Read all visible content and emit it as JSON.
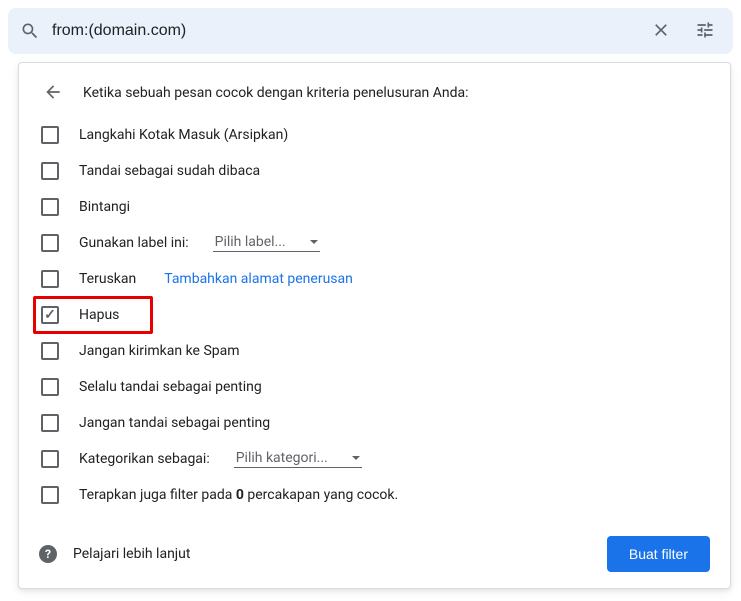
{
  "search": {
    "query": "from:(domain.com)"
  },
  "panel": {
    "title": "Ketika sebuah pesan cocok dengan kriteria penelusuran Anda:",
    "learn_more": "Pelajari lebih lanjut",
    "create_filter": "Buat filter"
  },
  "label_dropdown": {
    "placeholder": "Pilih label..."
  },
  "category_dropdown": {
    "placeholder": "Pilih kategori..."
  },
  "forward": {
    "add_link": "Tambahkan alamat penerusan"
  },
  "apply_existing": {
    "prefix": "Terapkan juga filter pada ",
    "count": "0",
    "suffix": " percakapan yang cocok."
  },
  "options": {
    "skip_inbox": "Langkahi Kotak Masuk (Arsipkan)",
    "mark_read": "Tandai sebagai sudah dibaca",
    "star": "Bintangi",
    "apply_label": "Gunakan label ini:",
    "forward": "Teruskan",
    "delete": "Hapus",
    "never_spam": "Jangan kirimkan ke Spam",
    "always_important": "Selalu tandai sebagai penting",
    "never_important": "Jangan tandai sebagai penting",
    "categorize": "Kategorikan sebagai:"
  }
}
